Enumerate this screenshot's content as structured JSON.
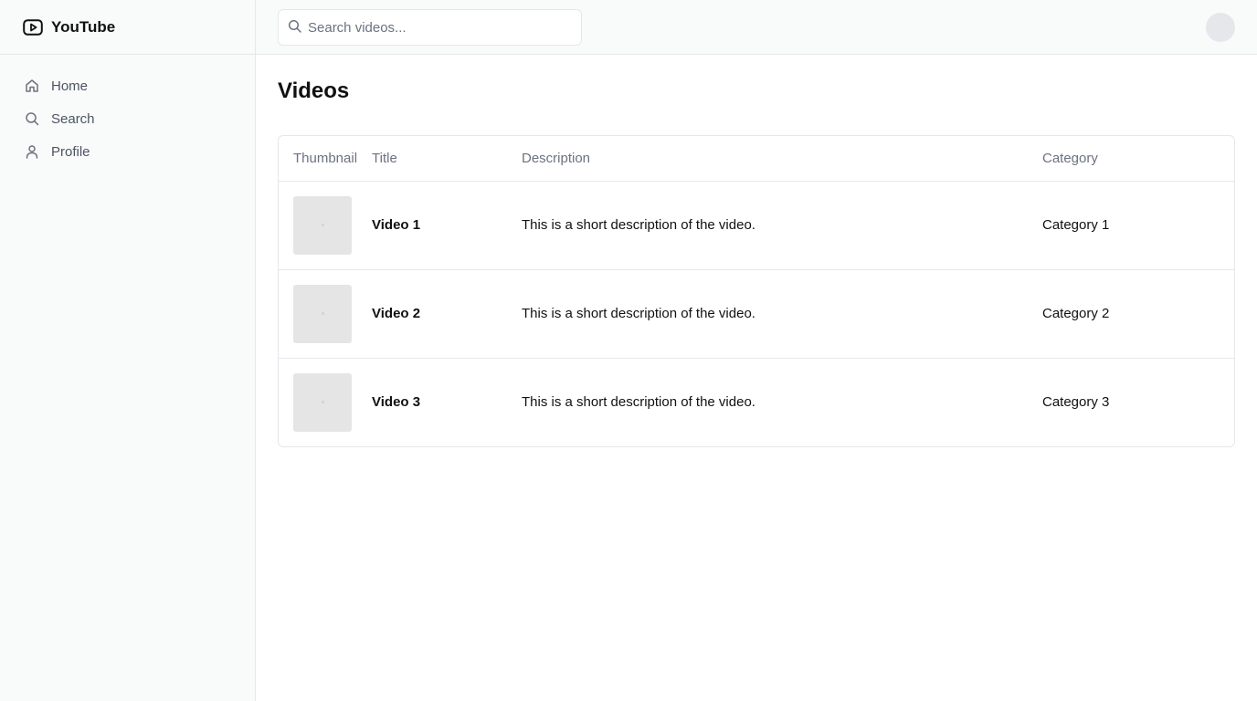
{
  "brand": {
    "name": "YouTube",
    "icon": "youtube-logo-icon"
  },
  "sidebar": {
    "items": [
      {
        "label": "Home",
        "icon": "home-icon"
      },
      {
        "label": "Search",
        "icon": "search-icon"
      },
      {
        "label": "Profile",
        "icon": "user-icon"
      }
    ]
  },
  "topbar": {
    "search": {
      "placeholder": "Search videos...",
      "value": ""
    }
  },
  "main": {
    "title": "Videos",
    "table": {
      "headers": {
        "thumbnail": "Thumbnail",
        "title": "Title",
        "description": "Description",
        "category": "Category"
      },
      "rows": [
        {
          "title": "Video 1",
          "description": "This is a short description of the video.",
          "category": "Category 1"
        },
        {
          "title": "Video 2",
          "description": "This is a short description of the video.",
          "category": "Category 2"
        },
        {
          "title": "Video 3",
          "description": "This is a short description of the video.",
          "category": "Category 3"
        }
      ]
    }
  },
  "colors": {
    "sidebar_bg": "#f9fafa",
    "border": "#e5e7eb",
    "muted_text": "#6b7280",
    "thumbnail_bg": "#e5e5e5"
  }
}
